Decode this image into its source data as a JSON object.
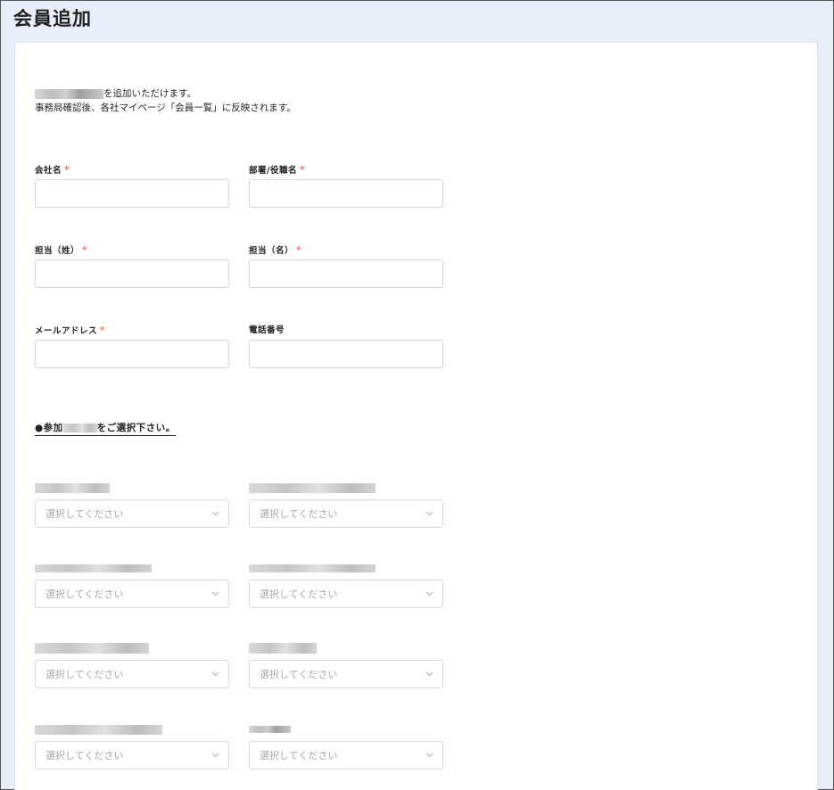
{
  "page_title": "会員追加",
  "intro": {
    "line1_suffix": "を追加いただけます。",
    "line2": "事務局確認後、各社マイページ「会員一覧」に反映されます。"
  },
  "form": {
    "company_name": {
      "label": "会社名",
      "required": "*",
      "value": ""
    },
    "department_title": {
      "label": "部署/役職名",
      "required": "*",
      "value": ""
    },
    "last_name": {
      "label": "担当（姓）",
      "required": "*",
      "value": ""
    },
    "first_name": {
      "label": "担当（名）",
      "required": "*",
      "value": ""
    },
    "email": {
      "label": "メールアドレス",
      "required": "*",
      "value": ""
    },
    "phone": {
      "label": "電話番号",
      "value": ""
    }
  },
  "section": {
    "prefix": "●参加",
    "suffix": "をご選択下さい。"
  },
  "selects": {
    "placeholder": "選択してください"
  },
  "colors": {
    "background": "#e8eef9",
    "required": "#e0452b",
    "border": "#cfd4dc"
  }
}
